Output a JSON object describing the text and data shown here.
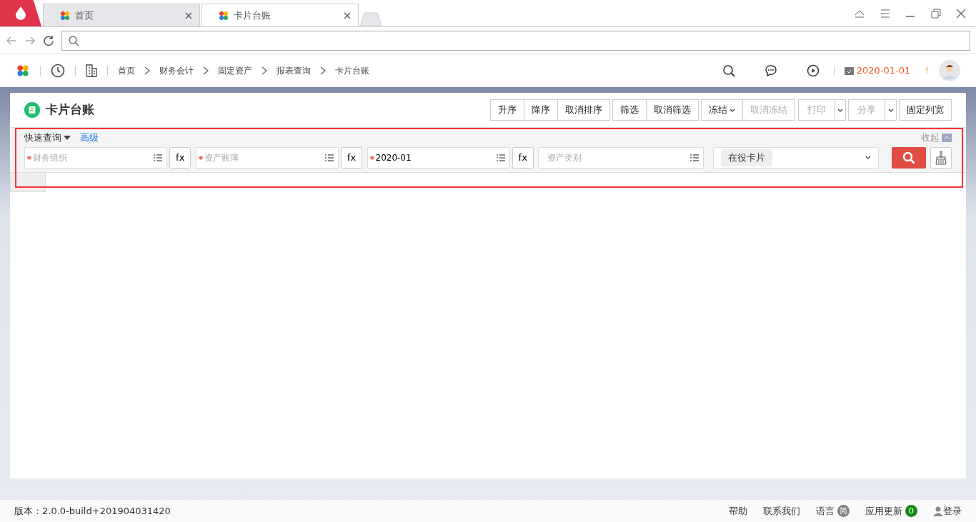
{
  "browser": {
    "tabs": [
      {
        "label": "首页",
        "selected": false
      },
      {
        "label": "卡片台账",
        "selected": true
      }
    ]
  },
  "header": {
    "breadcrumb": [
      "首页",
      "财务会计",
      "固定资产",
      "报表查询",
      "卡片台账"
    ],
    "date": "2020-01-01",
    "alert": "!"
  },
  "page": {
    "title": "卡片台账",
    "toolbar": [
      [
        {
          "kind": "plain",
          "label": "升序",
          "disabled": false
        },
        {
          "kind": "plain",
          "label": "降序",
          "disabled": false
        },
        {
          "kind": "plain",
          "label": "取消排序",
          "disabled": false
        }
      ],
      [
        {
          "kind": "plain",
          "label": "筛选",
          "disabled": false
        },
        {
          "kind": "plain",
          "label": "取消筛选",
          "disabled": false
        }
      ],
      [
        {
          "kind": "menu",
          "label": "冻结",
          "disabled": false
        },
        {
          "kind": "plain",
          "label": "取消冻结",
          "disabled": true
        }
      ],
      [
        {
          "kind": "split",
          "label": "打印",
          "disabled": true
        }
      ],
      [
        {
          "kind": "split",
          "label": "分享",
          "disabled": true
        }
      ],
      [
        {
          "kind": "plain",
          "label": "固定列宽",
          "disabled": false
        }
      ]
    ],
    "query": {
      "mode": "快速查询",
      "advanced": "高级",
      "collapse": "收起",
      "fields": [
        {
          "kind": "ref",
          "placeholder": "财务组织",
          "required": true,
          "fx": "fx"
        },
        {
          "kind": "ref",
          "placeholder": "资产账簿",
          "required": true,
          "fx": "fx"
        },
        {
          "kind": "ref",
          "value": "2020-01",
          "required": true,
          "fx": "fx"
        },
        {
          "kind": "ref",
          "placeholder": "资产类别",
          "required": false
        },
        {
          "kind": "select",
          "tags": [
            "在役卡片"
          ]
        }
      ]
    }
  },
  "footer": {
    "version": "版本：2.0.0-build+201904031420",
    "links": [
      {
        "kind": "text",
        "label": "帮助"
      },
      {
        "kind": "text",
        "label": "联系我们"
      },
      {
        "kind": "badge",
        "label": "语言",
        "badge": "简",
        "color": "#808080"
      },
      {
        "kind": "badge",
        "label": "应用更新",
        "badge": "0",
        "color": "#118a11"
      },
      {
        "kind": "user",
        "label": "登录"
      }
    ]
  }
}
